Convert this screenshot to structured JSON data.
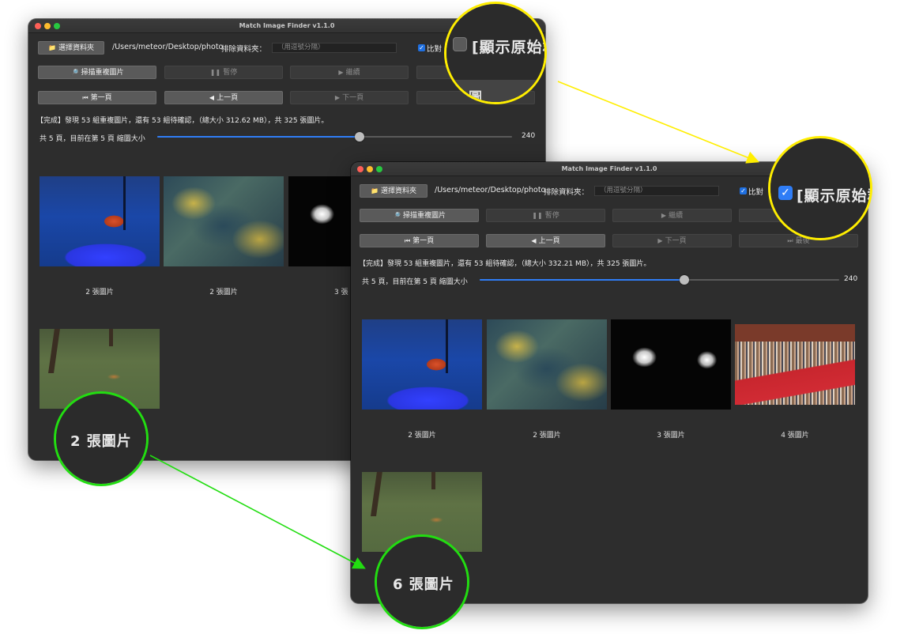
{
  "window_before": {
    "title": "Match Image Finder v1.1.0",
    "choose_folder": "選擇資料夾",
    "folder_path": "/Users/meteor/Desktop/photo",
    "exclude_label": "排除資料夾：",
    "exclude_placeholder": "（用逗號分隔）",
    "compare_label": "比對",
    "scan": "掃描重複圖片",
    "pause": "暫停",
    "resume": "繼續",
    "first_page": "第一頁",
    "prev_page": "上一頁",
    "next_page": "下一頁",
    "last_page": "最後",
    "status": "【完成】發現 53 組重複圖片，還有 53 組待確認，（總大小 312.62 MB），共 325 張圖片。",
    "pager": "共 5 頁，目前在第 5 頁 縮圖大小",
    "slider_value": "240",
    "slider_fraction": 0.57,
    "groups": [
      {
        "caption": "2 張圖片",
        "kind": "fish"
      },
      {
        "caption": "2 張圖片",
        "kind": "water"
      },
      {
        "caption": "3 張",
        "kind": "sparkle"
      },
      {
        "caption": "",
        "kind": "grass"
      }
    ]
  },
  "window_after": {
    "title": "Match Image Finder v1.1.0",
    "choose_folder": "選擇資料夾",
    "folder_path": "/Users/meteor/Desktop/photo",
    "exclude_label": "排除資料夾：",
    "exclude_placeholder": "（用逗號分隔）",
    "compare_label": "比對",
    "scan": "掃描重複圖片",
    "pause": "暫停",
    "resume": "繼續",
    "first_page": "第一頁",
    "prev_page": "上一頁",
    "next_page": "下一頁",
    "last_page": "最後",
    "status": "【完成】發現 53 組重複圖片，還有 53 組待確認，（總大小 332.21 MB），共 325 張圖片。",
    "pager": "共 5 頁，目前在第 5 頁 縮圖大小",
    "slider_value": "240",
    "slider_fraction": 0.57,
    "groups": [
      {
        "caption": "2 張圖片",
        "kind": "fish"
      },
      {
        "caption": "2 張圖片",
        "kind": "water"
      },
      {
        "caption": "3 張圖片",
        "kind": "sparkle"
      },
      {
        "caption": "4 張圖片",
        "kind": "crowd"
      },
      {
        "caption": "",
        "kind": "grass"
      }
    ]
  },
  "callouts": {
    "show_original_before": "[顯示原始群",
    "show_original_after": "[顯示原始群",
    "count_before": "2 張圖片",
    "count_after": "6 張圖片",
    "fragment_before": "圖"
  },
  "colors": {
    "yellow": "#ffee00",
    "green": "#22dd11",
    "accent": "#2f7df6"
  }
}
